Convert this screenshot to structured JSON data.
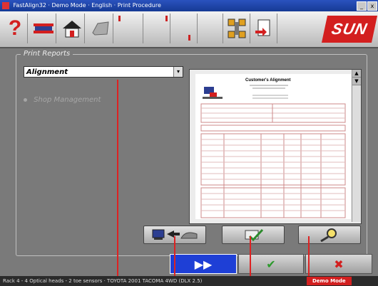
{
  "window": {
    "title": "FastAlign32 · Demo Mode · English · Print Procedure",
    "min_label": "_",
    "close_label": "x"
  },
  "toolbar": {
    "help_icon": "question-mark-icon",
    "brand_text": "SUN",
    "colors": {
      "brand_red": "#d31f1f",
      "toolbar_bg": "#dcdcdc"
    }
  },
  "print_reports": {
    "section_title": "Print Reports",
    "selected_report": "Alignment",
    "disabled_option": "Shop Management"
  },
  "report_preview": {
    "title": "Customer's Alignment",
    "scroll_up": "▲",
    "scroll_down": "▼"
  },
  "actions": {
    "export_icon": "computer-to-vehicle-icon",
    "printer_setup_icon": "printer-check-icon",
    "zoom_icon": "magnifier-icon"
  },
  "navigation": {
    "next_symbol": "▶▶",
    "confirm_symbol": "✔",
    "cancel_symbol": "✖"
  },
  "status": {
    "text": "Rack 4 - 4 Optical heads - 2 toe sensors  ·  TOYOTA 2001 TACOMA 4WD (DLX 2.5)",
    "mode": "Demo Mode"
  }
}
